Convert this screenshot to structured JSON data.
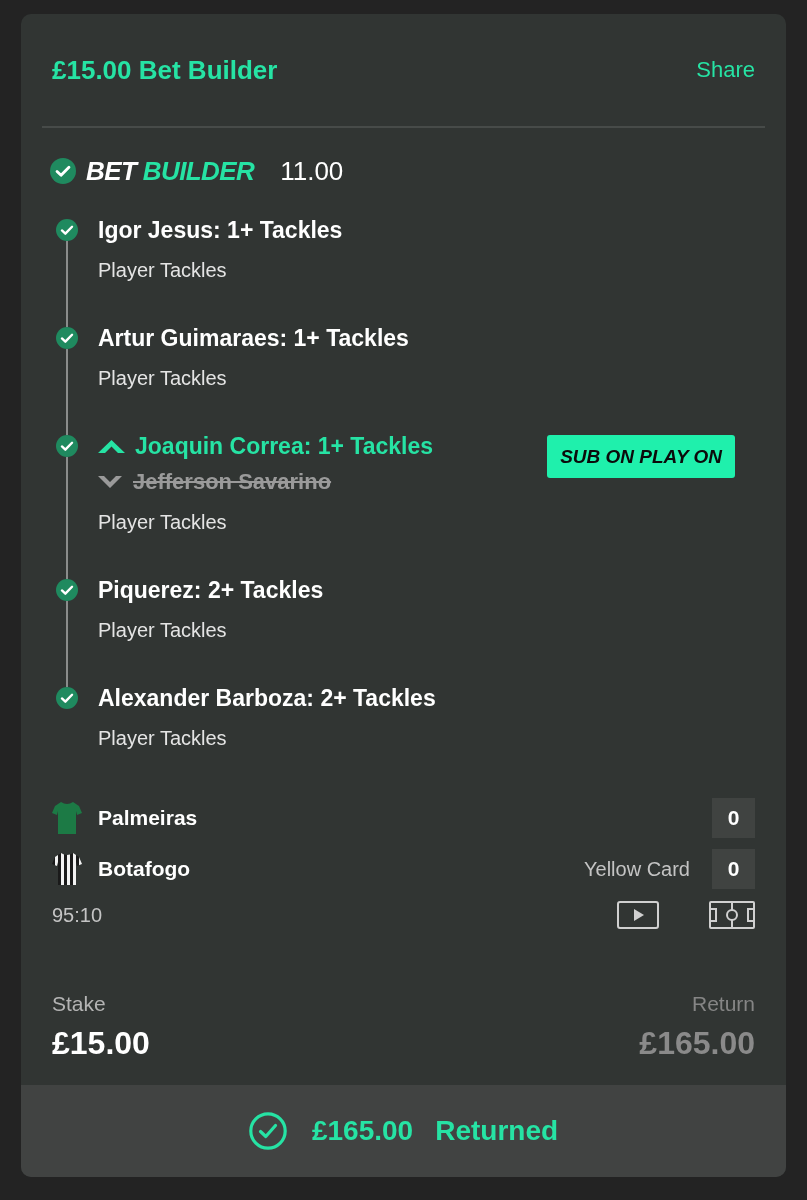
{
  "header": {
    "title": "£15.00 Bet Builder",
    "share": "Share"
  },
  "bet_builder": {
    "won": true,
    "logo": {
      "first": "BET",
      "second": "BUILDER"
    },
    "odds": "11.00"
  },
  "legs": [
    {
      "kind": "standard",
      "won": true,
      "title": "Igor Jesus: 1+ Tackles",
      "market": "Player Tackles"
    },
    {
      "kind": "standard",
      "won": true,
      "title": "Artur Guimaraes: 1+ Tackles",
      "market": "Player Tackles"
    },
    {
      "kind": "substitution",
      "won": true,
      "title": "Joaquin Correa: 1+ Tackles",
      "replaced": "Jefferson Savarino",
      "badge": "SUB ON PLAY ON",
      "market": "Player Tackles"
    },
    {
      "kind": "standard",
      "won": true,
      "title": "Piquerez: 2+ Tackles",
      "market": "Player Tackles"
    },
    {
      "kind": "standard",
      "won": true,
      "title": "Alexander Barboza: 2+ Tackles",
      "market": "Player Tackles"
    }
  ],
  "match": {
    "teams": [
      {
        "name": "Palmeiras",
        "kind": "solid",
        "color": "#1c7a45",
        "score": "0"
      },
      {
        "name": "Botafogo",
        "kind": "striped",
        "color": "#1a1a1a",
        "stat_label": "Yellow Card",
        "score": "0"
      }
    ],
    "clock": "95:10"
  },
  "stake": {
    "label": "Stake",
    "amount": "£15.00"
  },
  "return": {
    "label": "Return",
    "amount": "£165.00"
  },
  "result": {
    "amount": "£165.00",
    "label": "Returned"
  }
}
